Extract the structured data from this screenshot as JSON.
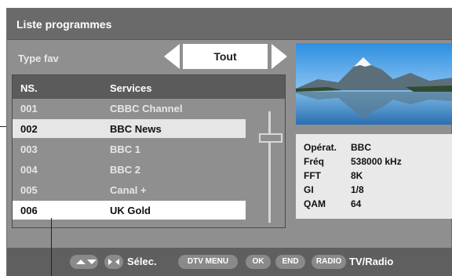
{
  "title": "Liste programmes",
  "fav": {
    "label": "Type fav",
    "value": "Tout"
  },
  "list": {
    "headers": {
      "ns": "NS.",
      "services": "Services"
    },
    "rows": [
      {
        "ns": "001",
        "service": "CBBC Channel"
      },
      {
        "ns": "002",
        "service": "BBC News"
      },
      {
        "ns": "003",
        "service": "BBC 1"
      },
      {
        "ns": "004",
        "service": "BBC 2"
      },
      {
        "ns": "005",
        "service": "Canal +"
      },
      {
        "ns": "006",
        "service": "UK Gold"
      }
    ]
  },
  "info": {
    "operator_label": "Opérat.",
    "operator_value": "BBC",
    "freq_label": "Fréq",
    "freq_value": "538000 kHz",
    "fft_label": "FFT",
    "fft_value": "8K",
    "gi_label": "GI",
    "gi_value": "1/8",
    "qam_label": "QAM",
    "qam_value": "64"
  },
  "footer": {
    "select_label": "Sélec.",
    "dtv_menu": "DTV MENU",
    "ok": "OK",
    "end": "END",
    "radio": "RADIO",
    "tv_radio_label": "TV/Radio"
  },
  "colors": {
    "accent_title_bar": "#6a6a6a",
    "panel_grey": "#8f8f8f",
    "highlight_white": "#ffffff"
  },
  "icons": {
    "left_arrow": "triangle-left",
    "right_arrow": "triangle-right",
    "updown": "up-down-arrows",
    "leftright": "left-right-arrows"
  }
}
